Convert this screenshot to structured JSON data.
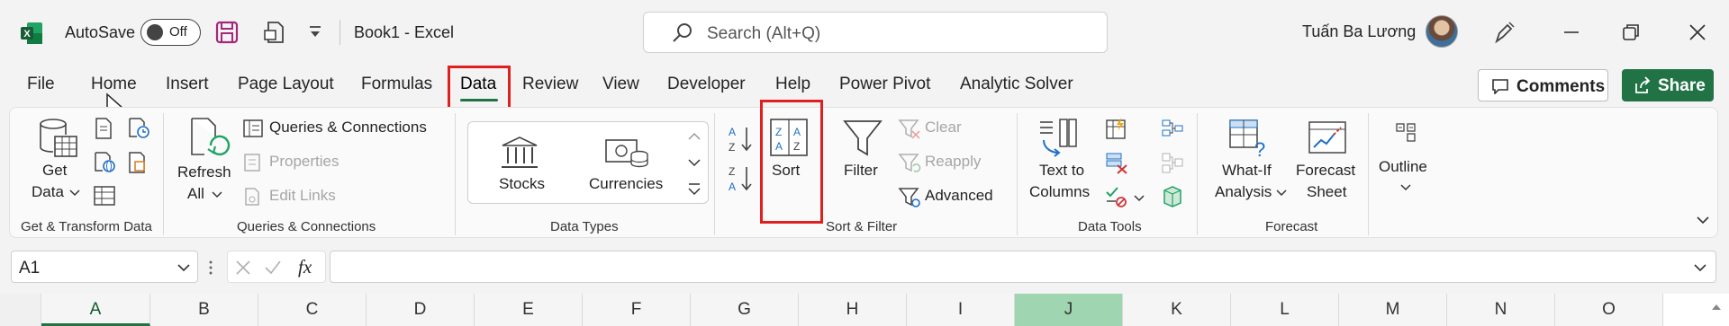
{
  "titlebar": {
    "autosave_label": "AutoSave",
    "autosave_state": "Off",
    "doc_title": "Book1  -  Excel",
    "search_placeholder": "Search (Alt+Q)",
    "user_name": "Tuấn Ba Lương"
  },
  "tabs": [
    "File",
    "Home",
    "Insert",
    "Page Layout",
    "Formulas",
    "Data",
    "Review",
    "View",
    "Developer",
    "Help",
    "Power Pivot",
    "Analytic Solver"
  ],
  "active_tab": "Data",
  "actions": {
    "comments": "Comments",
    "share": "Share"
  },
  "ribbon": {
    "get_transform": {
      "label": "Get & Transform Data",
      "get_data_line1": "Get",
      "get_data_line2": "Data"
    },
    "queries": {
      "label": "Queries & Connections",
      "refresh_line1": "Refresh",
      "refresh_line2": "All",
      "queries_connections": "Queries & Connections",
      "properties": "Properties",
      "edit_links": "Edit Links"
    },
    "data_types": {
      "label": "Data Types",
      "stocks": "Stocks",
      "currencies": "Currencies"
    },
    "sort_filter": {
      "label": "Sort & Filter",
      "sort": "Sort",
      "filter": "Filter",
      "clear": "Clear",
      "reapply": "Reapply",
      "advanced": "Advanced"
    },
    "data_tools": {
      "label": "Data Tools",
      "text_to_columns_line1": "Text to",
      "text_to_columns_line2": "Columns"
    },
    "forecast": {
      "label": "Forecast",
      "whatif_line1": "What-If",
      "whatif_line2": "Analysis",
      "forecast_line1": "Forecast",
      "forecast_line2": "Sheet"
    },
    "outline": {
      "label": "Outline"
    }
  },
  "formula_bar": {
    "name_box": "A1",
    "fx": "fx",
    "formula": ""
  },
  "columns": [
    "A",
    "B",
    "C",
    "D",
    "E",
    "F",
    "G",
    "H",
    "I",
    "J",
    "K",
    "L",
    "M",
    "N",
    "O"
  ],
  "colors": {
    "excel_green": "#217346",
    "highlight_red": "#e02020",
    "selected_col": "#9fd5b1"
  }
}
